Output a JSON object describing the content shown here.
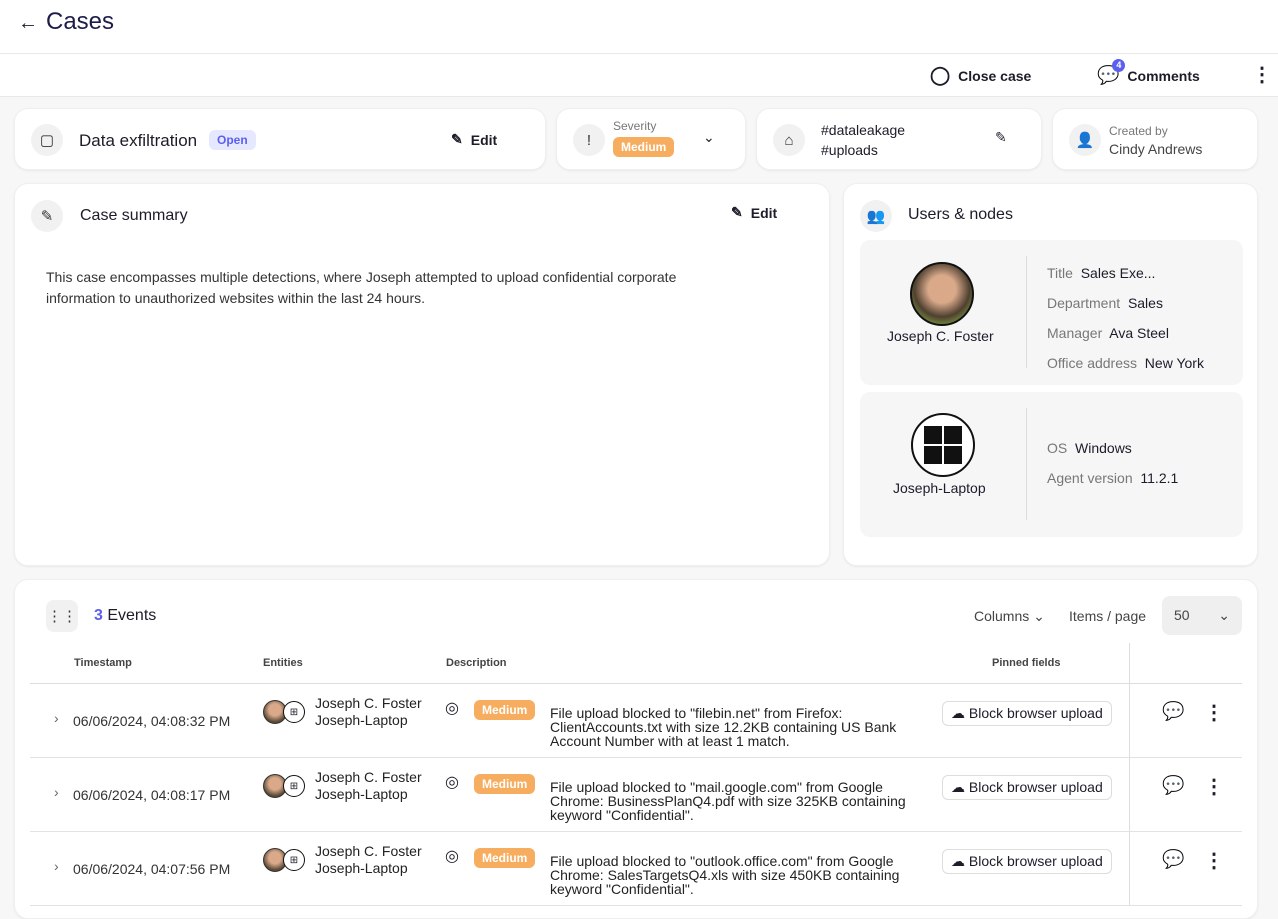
{
  "header": {
    "title": "Cases",
    "close_case": "Close case",
    "comments": "Comments",
    "comments_count": "4"
  },
  "case": {
    "name": "Data exfiltration",
    "status": "Open",
    "edit": "Edit"
  },
  "severity": {
    "label": "Severity",
    "value": "Medium"
  },
  "tags": [
    "#dataleakage",
    "#uploads"
  ],
  "created": {
    "label": "Created by",
    "value": "Cindy Andrews"
  },
  "summary": {
    "title": "Case summary",
    "edit": "Edit",
    "text": "This case encompasses multiple detections, where Joseph attempted to upload confidential corporate information to unauthorized websites within the last 24 hours."
  },
  "users_nodes": {
    "title": "Users & nodes",
    "user": {
      "name": "Joseph C. Foster",
      "fields": [
        {
          "k": "Title",
          "v": "Sales Exe..."
        },
        {
          "k": "Department",
          "v": "Sales"
        },
        {
          "k": "Manager",
          "v": "Ava Steel"
        },
        {
          "k": "Office address",
          "v": "New York"
        }
      ]
    },
    "node": {
      "name": "Joseph-Laptop",
      "fields": [
        {
          "k": "OS",
          "v": "Windows"
        },
        {
          "k": "Agent version",
          "v": "11.2.1"
        }
      ]
    }
  },
  "events": {
    "count": "3",
    "label": "Events",
    "columns": "Columns",
    "items_per_page": "Items / page",
    "page_size": "50",
    "headers": [
      "Timestamp",
      "Entities",
      "Description",
      "Pinned fields"
    ],
    "rows": [
      {
        "ts": "06/06/2024, 04:08:32 PM",
        "user": "Joseph C. Foster",
        "node": "Joseph-Laptop",
        "sev": "Medium",
        "desc": "File upload blocked to \"filebin.net\" from Firefox: ClientAccounts.txt with size 12.2KB containing US Bank Account Number with at least 1 match.",
        "pin": "Block browser upload"
      },
      {
        "ts": "06/06/2024, 04:08:17 PM",
        "user": "Joseph C. Foster",
        "node": "Joseph-Laptop",
        "sev": "Medium",
        "desc": "File upload blocked to \"mail.google.com\" from Google Chrome: BusinessPlanQ4.pdf with size 325KB containing keyword \"Confidential\".",
        "pin": "Block browser upload"
      },
      {
        "ts": "06/06/2024, 04:07:56 PM",
        "user": "Joseph C. Foster",
        "node": "Joseph-Laptop",
        "sev": "Medium",
        "desc": "File upload blocked to \"outlook.office.com\" from Google Chrome: SalesTargetsQ4.xls with size 450KB containing keyword \"Confidential\".",
        "pin": "Block browser upload"
      }
    ]
  }
}
